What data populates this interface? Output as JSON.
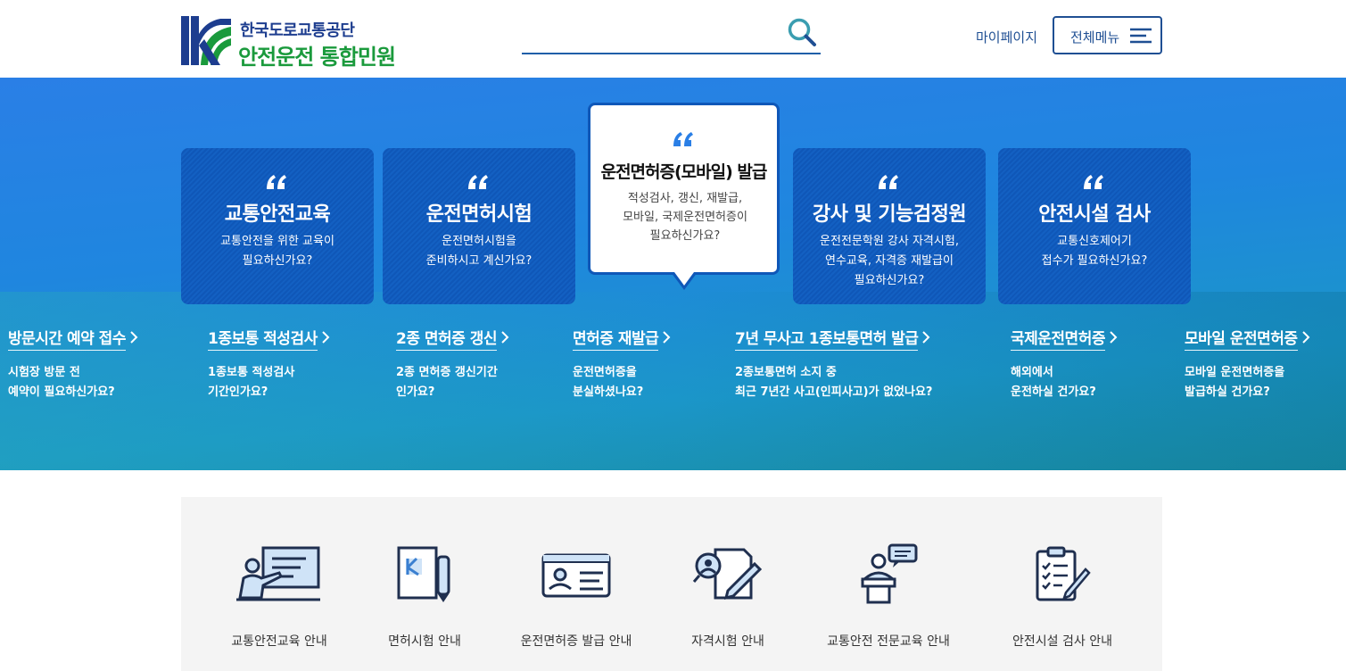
{
  "header": {
    "org_name": "한국도로교통공단",
    "site_title": "안전운전 통합민원",
    "search_placeholder": "",
    "mypage_label": "마이페이지",
    "allmenu_label": "전체메뉴"
  },
  "colors": {
    "brand_blue": "#1d3d8f",
    "brand_green": "#1a9a3c",
    "hero_blue": "#2a7fe6",
    "card_blue": "#0f57b8",
    "search_icon": "#3a9db0"
  },
  "cards": [
    {
      "title": "교통안전교육",
      "desc_line1": "교통안전을 위한 교육이",
      "desc_line2": "필요하신가요?",
      "desc_line3": ""
    },
    {
      "title": "운전면허시험",
      "desc_line1": "운전면허시험을",
      "desc_line2": "준비하시고 계신가요?",
      "desc_line3": ""
    },
    {
      "title": "운전면허증(모바일) 발급",
      "desc_line1": "적성검사, 갱신, 재발급,",
      "desc_line2": "모바일, 국제운전면허증이",
      "desc_line3": "필요하신가요?"
    },
    {
      "title": "강사 및 기능검정원",
      "desc_line1": "운전전문학원 강사 자격시험,",
      "desc_line2": "연수교육, 자격증 재발급이",
      "desc_line3": "필요하신가요?"
    },
    {
      "title": "안전시설 검사",
      "desc_line1": "교통신호제어기",
      "desc_line2": "접수가 필요하신가요?",
      "desc_line3": ""
    }
  ],
  "links": [
    {
      "title": "방문시간 예약 접수",
      "desc_line1": "시험장 방문 전",
      "desc_line2": "예약이 필요하신가요?"
    },
    {
      "title": "1종보통 적성검사",
      "desc_line1": "1종보통 적성검사",
      "desc_line2": "기간인가요?"
    },
    {
      "title": "2종 면허증 갱신",
      "desc_line1": "2종 면허증 갱신기간",
      "desc_line2": "인가요?"
    },
    {
      "title": "면허증 재발급",
      "desc_line1": "운전면허증을",
      "desc_line2": "분실하셨나요?"
    },
    {
      "title": "7년 무사고 1종보통면허 발급",
      "desc_line1": "2종보통면허 소지 중",
      "desc_line2": "최근 7년간 사고(인피사고)가 없었나요?"
    },
    {
      "title": "국제운전면허증",
      "desc_line1": "해외에서",
      "desc_line2": "운전하실 건가요?"
    },
    {
      "title": "모바일 운전면허증",
      "desc_line1": "모바일 운전면허증을",
      "desc_line2": "발급하실 건가요?"
    }
  ],
  "quick_menu": [
    {
      "label": "교통안전교육 안내",
      "icon": "teacher-board-icon"
    },
    {
      "label": "면허시험 안내",
      "icon": "license-pen-icon"
    },
    {
      "label": "운전면허증 발급 안내",
      "icon": "id-card-icon"
    },
    {
      "label": "자격시험 안내",
      "icon": "exam-search-icon"
    },
    {
      "label": "교통안전 전문교육 안내",
      "icon": "lecturer-podium-icon"
    },
    {
      "label": "안전시설 검사 안내",
      "icon": "checklist-clipboard-icon"
    }
  ]
}
